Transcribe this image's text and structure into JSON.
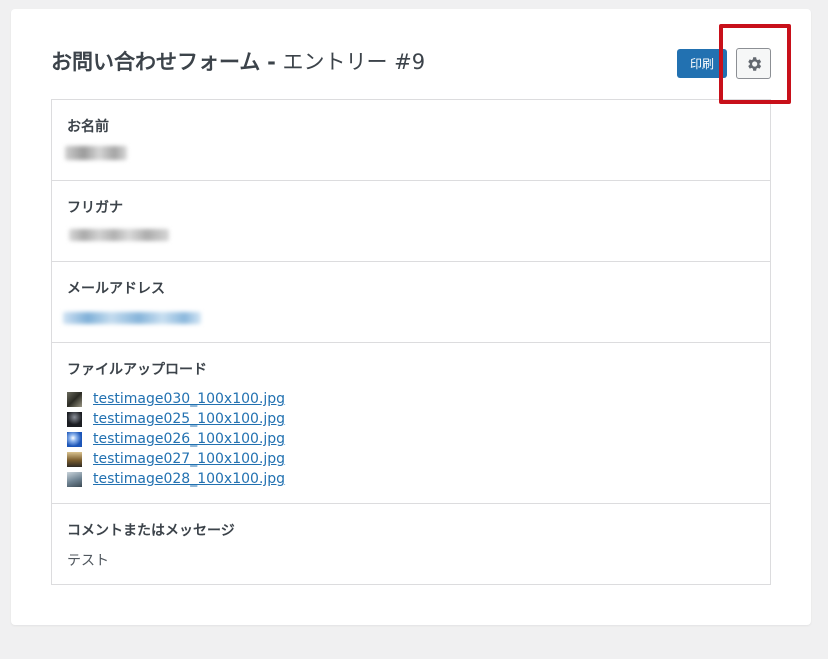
{
  "header": {
    "form_name": "お問い合わせフォーム",
    "separator": "-",
    "entry_label": "エントリー #9",
    "print_label": "印刷",
    "settings_icon": "gear-icon"
  },
  "fields": {
    "name": {
      "label": "お名前"
    },
    "furigana": {
      "label": "フリガナ"
    },
    "email": {
      "label": "メールアドレス"
    },
    "upload": {
      "label": "ファイルアップロード",
      "files": [
        "testimage030_100x100.jpg",
        "testimage025_100x100.jpg",
        "testimage026_100x100.jpg",
        "testimage027_100x100.jpg",
        "testimage028_100x100.jpg"
      ]
    },
    "comment": {
      "label": "コメントまたはメッセージ",
      "value": "テスト"
    }
  },
  "colors": {
    "accent": "#2271b1",
    "highlight": "#c8101a",
    "background": "#f0f0f1"
  }
}
